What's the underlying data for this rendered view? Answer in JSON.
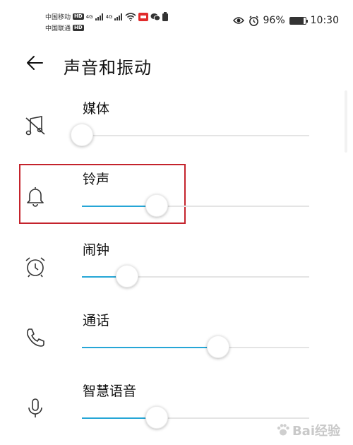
{
  "status_bar": {
    "carrier1": "中国移动",
    "carrier2": "中国联通",
    "hd": "HD",
    "net": "4G",
    "battery_percent": "96%",
    "time": "10:30"
  },
  "header": {
    "title": "声音和振动"
  },
  "volume_rows": [
    {
      "label": "媒体",
      "icon": "music-muted-icon",
      "level": 0
    },
    {
      "label": "铃声",
      "icon": "bell-icon",
      "level": 0.33
    },
    {
      "label": "闹钟",
      "icon": "alarm-clock-icon",
      "level": 0.2
    },
    {
      "label": "通话",
      "icon": "phone-icon",
      "level": 0.6
    },
    {
      "label": "智慧语音",
      "icon": "microphone-icon",
      "level": 0.33
    }
  ],
  "watermark": {
    "text": "Bai经验"
  },
  "colors": {
    "accent": "#26a6d6",
    "highlight": "#c4232c"
  }
}
